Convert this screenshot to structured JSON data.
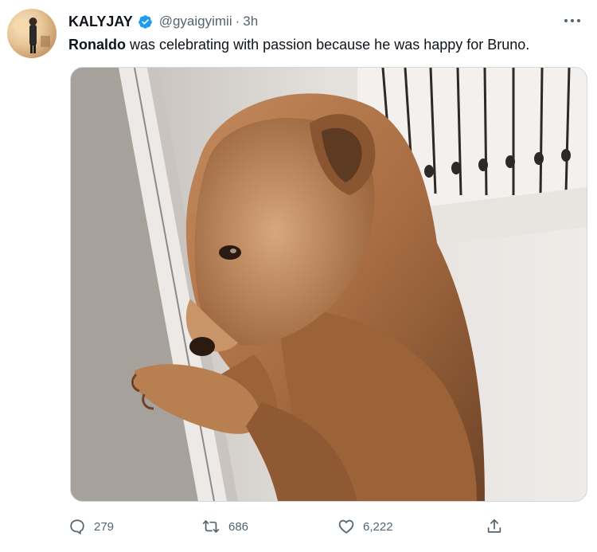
{
  "tweet": {
    "author": {
      "display_name": "KALYJAY",
      "handle": "@gyaigyimii",
      "separator": "·",
      "time": "3h",
      "verified": true
    },
    "text": {
      "mention": "Ronaldo",
      "body": " was celebrating with passion because he was happy for Bruno."
    },
    "media": {
      "description_icon": "dog-photo"
    },
    "actions": {
      "reply_count": "279",
      "retweet_count": "686",
      "like_count": "6,222"
    }
  },
  "icons": {
    "more": "more-horizontal-icon",
    "reply": "reply-icon",
    "retweet": "retweet-icon",
    "like": "heart-icon",
    "share": "share-icon",
    "verified": "verified-badge-icon"
  },
  "colors": {
    "text_primary": "#0f1419",
    "text_secondary": "#536471",
    "verified_blue": "#1d9bf0",
    "border": "#cfd9de"
  }
}
